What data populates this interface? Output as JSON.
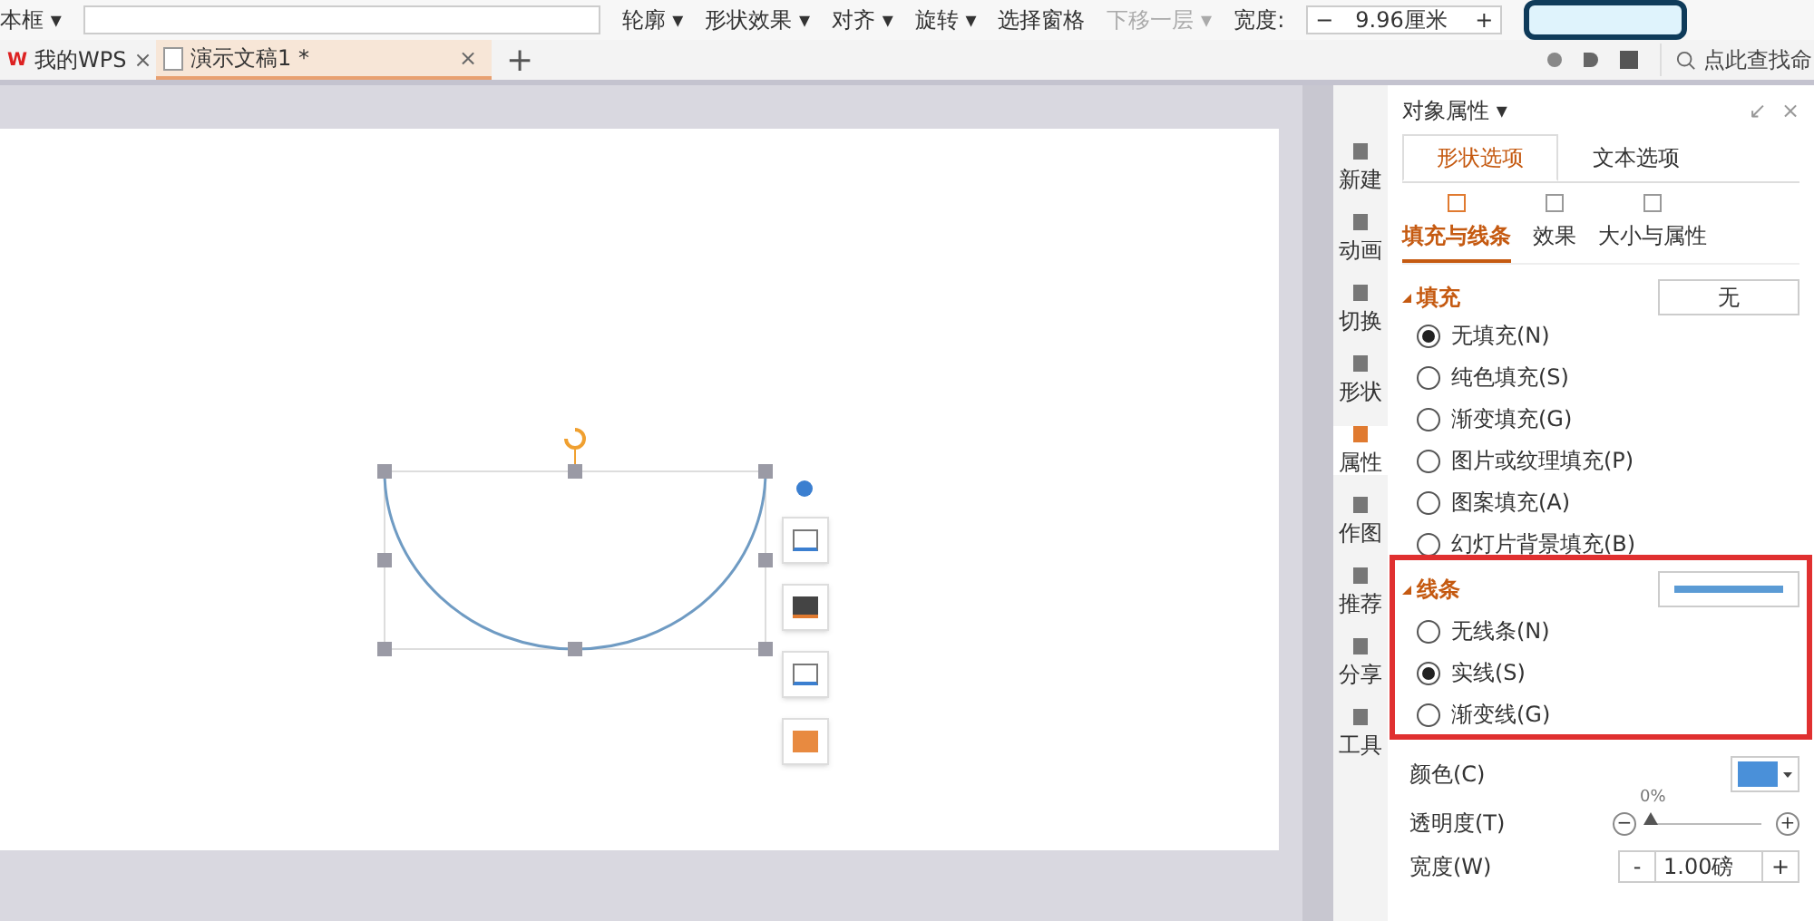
{
  "toolbar": {
    "items": [
      {
        "label": "本框",
        "caret": "▾",
        "disabled": false
      },
      {
        "label": "轮廓",
        "caret": "▾",
        "disabled": false
      },
      {
        "label": "形状效果",
        "caret": "▾",
        "disabled": false
      },
      {
        "label": "对齐",
        "caret": "▾",
        "disabled": false
      },
      {
        "label": "旋转",
        "caret": "▾",
        "disabled": false
      },
      {
        "label": "选择窗格",
        "disabled": false
      },
      {
        "label": "下移一层",
        "caret": "▾",
        "disabled": true
      }
    ],
    "width_label": "宽度:",
    "width_value": "9.96厘米",
    "minus": "−",
    "plus": "+"
  },
  "logo": "W",
  "tabs": [
    {
      "label": "我的WPS",
      "selected": false,
      "close": "×"
    },
    {
      "label": "演示文稿1 *",
      "selected": true,
      "close": "×"
    }
  ],
  "add_tab": "+",
  "search": {
    "placeholder": "点此查找命"
  },
  "side_nav": [
    {
      "label": "新建",
      "selected": false
    },
    {
      "label": "动画",
      "selected": false
    },
    {
      "label": "切换",
      "selected": false
    },
    {
      "label": "形状",
      "selected": false
    },
    {
      "label": "属性",
      "selected": true
    },
    {
      "label": "作图",
      "selected": false
    },
    {
      "label": "推荐",
      "selected": false
    },
    {
      "label": "分享",
      "selected": false
    },
    {
      "label": "工具",
      "selected": false
    }
  ],
  "panel": {
    "title": "对象属性",
    "title_caret": "▾",
    "restore": "↙",
    "close": "×",
    "tabs": [
      {
        "label": "形状选项",
        "selected": true
      },
      {
        "label": "文本选项",
        "selected": false
      }
    ],
    "subtabs": [
      {
        "label": "填充与线条",
        "selected": true
      },
      {
        "label": "效果",
        "selected": false
      },
      {
        "label": "大小与属性",
        "selected": false
      }
    ],
    "fill": {
      "title": "填充",
      "value": "无",
      "options": [
        {
          "label": "无填充(N)",
          "selected": true
        },
        {
          "label": "纯色填充(S)",
          "selected": false
        },
        {
          "label": "渐变填充(G)",
          "selected": false
        },
        {
          "label": "图片或纹理填充(P)",
          "selected": false
        },
        {
          "label": "图案填充(A)",
          "selected": false
        },
        {
          "label": "幻灯片背景填充(B)",
          "selected": false
        }
      ]
    },
    "line": {
      "title": "线条",
      "color": "#5b9bd5",
      "options": [
        {
          "label": "无线条(N)",
          "selected": false
        },
        {
          "label": "实线(S)",
          "selected": true
        },
        {
          "label": "渐变线(G)",
          "selected": false
        }
      ]
    },
    "color_label": "颜色(C)",
    "color": "#4a90d9",
    "transparency": {
      "label": "透明度(T)",
      "reading": "0%",
      "level": 0,
      "minus": "−",
      "plus": "+"
    },
    "width": {
      "label": "宽度(W)",
      "value": "1.00磅",
      "minus": "-",
      "plus": "+"
    }
  }
}
